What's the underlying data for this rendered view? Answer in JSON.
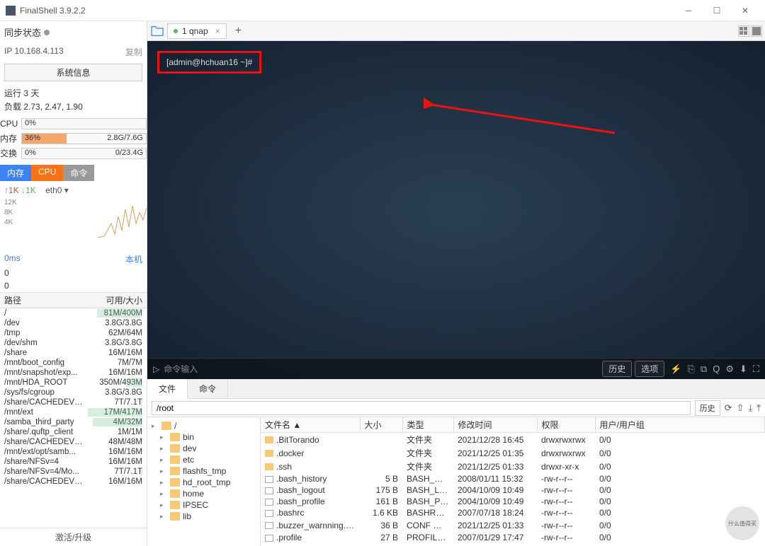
{
  "window": {
    "title": "FinalShell 3.9.2.2"
  },
  "sidebar": {
    "sync_label": "同步状态",
    "ip_label": "IP 10.168.4.113",
    "copy": "复制",
    "sysinfo_btn": "系统信息",
    "uptime": "运行 3 天",
    "load": "负载 2.73, 2.47, 1.90",
    "cpu": {
      "label": "CPU",
      "pct": "0%"
    },
    "mem": {
      "label": "内存",
      "pct": "36%",
      "used": "2.8G/7.6G",
      "fill": 36
    },
    "swap": {
      "label": "交换",
      "pct": "0%",
      "used": "0/23.4G"
    },
    "tabs": {
      "mem": "内存",
      "cpu": "CPU",
      "cmd": "命令"
    },
    "net": {
      "up": "↑1K",
      "down": "↓1K",
      "iface": "eth0 ▾",
      "ticks": [
        "12K",
        "8K",
        "4K"
      ]
    },
    "ping": "0ms",
    "ping_vals": [
      "0",
      "0"
    ],
    "host": "本机",
    "disk_header": {
      "path": "路径",
      "size": "可用/大小"
    },
    "disks": [
      {
        "path": "/",
        "size": "81M/400M",
        "u": 80
      },
      {
        "path": "/dev",
        "size": "3.8G/3.8G",
        "u": 0
      },
      {
        "path": "/tmp",
        "size": "62M/64M",
        "u": 3
      },
      {
        "path": "/dev/shm",
        "size": "3.8G/3.8G",
        "u": 0
      },
      {
        "path": "/share",
        "size": "16M/16M",
        "u": 0
      },
      {
        "path": "/mnt/boot_config",
        "size": "7M/7M",
        "u": 0
      },
      {
        "path": "/mnt/snapshot/exp...",
        "size": "16M/16M",
        "u": 0
      },
      {
        "path": "/mnt/HDA_ROOT",
        "size": "350M/493M",
        "u": 29
      },
      {
        "path": "/sys/fs/cgroup",
        "size": "3.8G/3.8G",
        "u": 0
      },
      {
        "path": "/share/CACHEDEV1...",
        "size": "7T/7.1T",
        "u": 2
      },
      {
        "path": "/mnt/ext",
        "size": "17M/417M",
        "u": 96
      },
      {
        "path": "/samba_third_party",
        "size": "4M/32M",
        "u": 88
      },
      {
        "path": "/share/.quftp_client",
        "size": "1M/1M",
        "u": 0
      },
      {
        "path": "/share/CACHEDEV1...",
        "size": "48M/48M",
        "u": 0
      },
      {
        "path": "/mnt/ext/opt/samb...",
        "size": "16M/16M",
        "u": 0
      },
      {
        "path": "/share/NFSv=4",
        "size": "16M/16M",
        "u": 0
      },
      {
        "path": "/share/NFSv=4/Mo...",
        "size": "7T/7.1T",
        "u": 2
      },
      {
        "path": "/share/CACHEDEV1...",
        "size": "16M/16M",
        "u": 0
      }
    ],
    "activate": "激活/升级"
  },
  "tabs": {
    "tab1": "1 qnap"
  },
  "terminal": {
    "prompt": "[admin@hchuan16 ~]#"
  },
  "cmdbar": {
    "placeholder": "命令输入",
    "history": "历史",
    "options": "选项"
  },
  "bottom_tabs": {
    "file": "文件",
    "cmd": "命令"
  },
  "pathbar": {
    "path": "/root",
    "history": "历史"
  },
  "tree": [
    "/",
    "bin",
    "dev",
    "etc",
    "flashfs_tmp",
    "hd_root_tmp",
    "home",
    "IPSEC",
    "lib"
  ],
  "file_table": {
    "cols": {
      "name": "文件名 ▲",
      "size": "大小",
      "type": "类型",
      "mtime": "修改时间",
      "perm": "权限",
      "owner": "用户/用户组"
    },
    "rows": [
      {
        "ico": "folder",
        "name": ".BitTorando",
        "size": "",
        "type": "文件夹",
        "mtime": "2021/12/28 16:45",
        "perm": "drwxrwxrwx",
        "owner": "0/0"
      },
      {
        "ico": "folder",
        "name": ".docker",
        "size": "",
        "type": "文件夹",
        "mtime": "2021/12/25 01:35",
        "perm": "drwxrwxrwx",
        "owner": "0/0"
      },
      {
        "ico": "folder",
        "name": ".ssh",
        "size": "",
        "type": "文件夹",
        "mtime": "2021/12/25 01:33",
        "perm": "drwxr-xr-x",
        "owner": "0/0"
      },
      {
        "ico": "file",
        "name": ".bash_history",
        "size": "5 B",
        "type": "BASH_HI...",
        "mtime": "2008/01/11 15:32",
        "perm": "-rw-r--r--",
        "owner": "0/0"
      },
      {
        "ico": "file",
        "name": ".bash_logout",
        "size": "175 B",
        "type": "BASH_LO...",
        "mtime": "2004/10/09 10:49",
        "perm": "-rw-r--r--",
        "owner": "0/0"
      },
      {
        "ico": "file",
        "name": ".bash_profile",
        "size": "161 B",
        "type": "BASH_PR...",
        "mtime": "2004/10/09 10:49",
        "perm": "-rw-r--r--",
        "owner": "0/0"
      },
      {
        "ico": "file",
        "name": ".bashrc",
        "size": "1.6 KB",
        "type": "BASHRC ...",
        "mtime": "2007/07/18 18:24",
        "perm": "-rw-r--r--",
        "owner": "0/0"
      },
      {
        "ico": "file",
        "name": ".buzzer_warnning.co...",
        "size": "36 B",
        "type": "CONF 文件",
        "mtime": "2021/12/25 01:33",
        "perm": "-rw-r--r--",
        "owner": "0/0"
      },
      {
        "ico": "file",
        "name": ".profile",
        "size": "27 B",
        "type": "PROFILE ...",
        "mtime": "2007/01/29 17:47",
        "perm": "-rw-r--r--",
        "owner": "0/0"
      }
    ]
  },
  "watermark": "什么值得买"
}
